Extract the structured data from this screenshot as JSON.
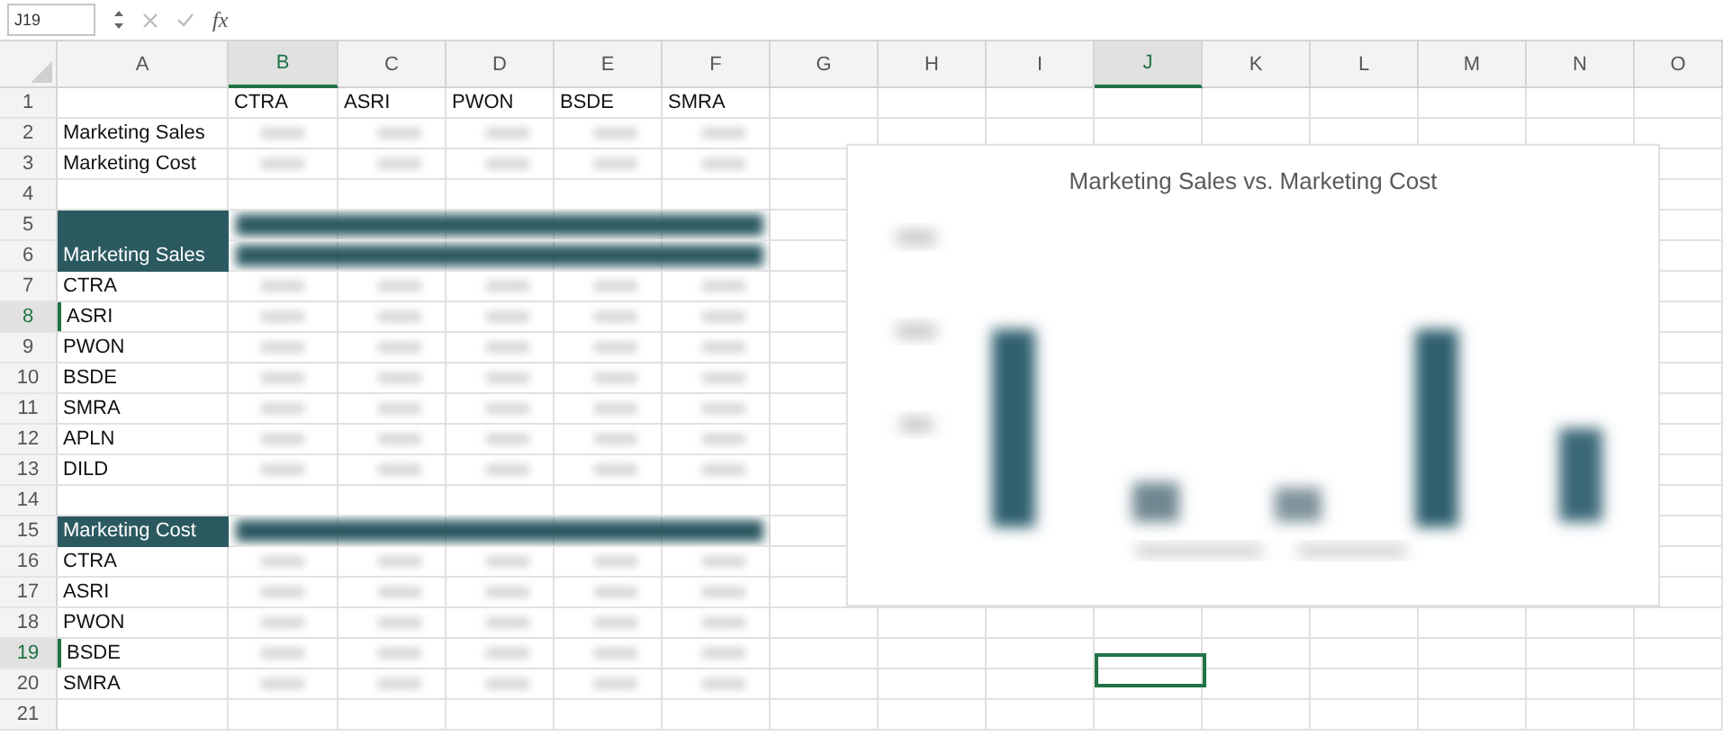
{
  "formula_bar": {
    "name_box": "J19",
    "function_label": "fx"
  },
  "columns": [
    {
      "label": "A",
      "selected": false
    },
    {
      "label": "B",
      "selected": true
    },
    {
      "label": "C",
      "selected": false
    },
    {
      "label": "D",
      "selected": false
    },
    {
      "label": "E",
      "selected": false
    },
    {
      "label": "F",
      "selected": false
    },
    {
      "label": "G",
      "selected": false
    },
    {
      "label": "H",
      "selected": false
    },
    {
      "label": "I",
      "selected": false
    },
    {
      "label": "J",
      "selected": true
    },
    {
      "label": "K",
      "selected": false
    },
    {
      "label": "L",
      "selected": false
    },
    {
      "label": "M",
      "selected": false
    },
    {
      "label": "N",
      "selected": false
    },
    {
      "label": "O",
      "selected": false
    }
  ],
  "rows": [
    {
      "number": "1",
      "selected": false,
      "label": "",
      "fill": false,
      "kind": "text",
      "cells": [
        "CTRA",
        "ASRI",
        "PWON",
        "BSDE",
        "SMRA"
      ]
    },
    {
      "number": "2",
      "selected": false,
      "label": "Marketing Sales",
      "fill": false,
      "kind": "blurred"
    },
    {
      "number": "3",
      "selected": false,
      "label": "Marketing Cost",
      "fill": false,
      "kind": "blurred"
    },
    {
      "number": "4",
      "selected": false,
      "label": "",
      "fill": false,
      "kind": "empty"
    },
    {
      "number": "5",
      "selected": false,
      "label": "",
      "fill": true,
      "kind": "dark"
    },
    {
      "number": "6",
      "selected": false,
      "label": "Marketing Sales",
      "fill": true,
      "kind": "dark"
    },
    {
      "number": "7",
      "selected": false,
      "label": "CTRA",
      "fill": false,
      "kind": "blurred"
    },
    {
      "number": "8",
      "selected": true,
      "label": "ASRI",
      "fill": false,
      "kind": "blurred"
    },
    {
      "number": "9",
      "selected": false,
      "label": "PWON",
      "fill": false,
      "kind": "blurred"
    },
    {
      "number": "10",
      "selected": false,
      "label": "BSDE",
      "fill": false,
      "kind": "blurred"
    },
    {
      "number": "11",
      "selected": false,
      "label": "SMRA",
      "fill": false,
      "kind": "blurred"
    },
    {
      "number": "12",
      "selected": false,
      "label": "APLN",
      "fill": false,
      "kind": "blurred"
    },
    {
      "number": "13",
      "selected": false,
      "label": "DILD",
      "fill": false,
      "kind": "blurred"
    },
    {
      "number": "14",
      "selected": false,
      "label": "",
      "fill": false,
      "kind": "empty"
    },
    {
      "number": "15",
      "selected": false,
      "label": "Marketing Cost",
      "fill": true,
      "kind": "dark"
    },
    {
      "number": "16",
      "selected": false,
      "label": "CTRA",
      "fill": false,
      "kind": "blurred"
    },
    {
      "number": "17",
      "selected": false,
      "label": "ASRI",
      "fill": false,
      "kind": "blurred"
    },
    {
      "number": "18",
      "selected": false,
      "label": "PWON",
      "fill": false,
      "kind": "blurred"
    },
    {
      "number": "19",
      "selected": true,
      "label": "BSDE",
      "fill": false,
      "kind": "blurred"
    },
    {
      "number": "20",
      "selected": false,
      "label": "SMRA",
      "fill": false,
      "kind": "blurred"
    },
    {
      "number": "21",
      "selected": false,
      "label": "",
      "fill": false,
      "kind": "empty"
    }
  ],
  "chart": {
    "title": "Marketing Sales vs. Marketing Cost"
  }
}
